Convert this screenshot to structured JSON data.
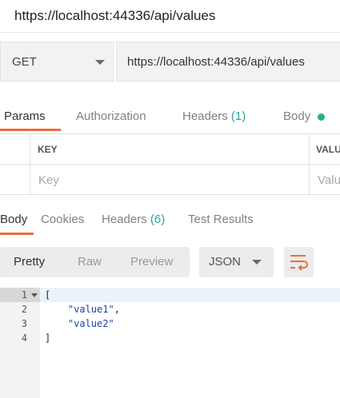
{
  "title_bar": {
    "title": "https://localhost:44336/api/values"
  },
  "request": {
    "method": "GET",
    "url": "https://localhost:44336/api/values"
  },
  "request_tabs": [
    {
      "label": "Params",
      "count": "",
      "active": true
    },
    {
      "label": "Authorization",
      "count": "",
      "active": false
    },
    {
      "label": "Headers",
      "count": "(1)",
      "active": false
    },
    {
      "label": "Body",
      "count": "",
      "active": false,
      "indicator": "green-dot"
    }
  ],
  "params_table": {
    "columns": [
      "KEY",
      "VALU"
    ],
    "placeholders": {
      "key": "Key",
      "value": "Valu"
    }
  },
  "response_tabs": [
    {
      "label": "Body",
      "count": "",
      "active": true
    },
    {
      "label": "Cookies",
      "count": "",
      "active": false
    },
    {
      "label": "Headers",
      "count": "(6)",
      "active": false
    },
    {
      "label": "Test Results",
      "count": "",
      "active": false
    }
  ],
  "response_toolbar": {
    "views": [
      "Pretty",
      "Raw",
      "Preview"
    ],
    "active_view": "Pretty",
    "format": "JSON",
    "wrap_icon": "wrap-lines-icon"
  },
  "editor": {
    "line_numbers": [
      "1",
      "2",
      "3",
      "4"
    ],
    "lines": [
      {
        "indent": "",
        "text": "["
      },
      {
        "indent": "    ",
        "text": "\"value1\"",
        "suffix": ","
      },
      {
        "indent": "    ",
        "text": "\"value2\"",
        "suffix": ""
      },
      {
        "indent": "",
        "text": "]"
      }
    ]
  },
  "colors": {
    "accent": "#f26b3a",
    "count": "#26a69a",
    "indicator": "#26b47e",
    "json_string": "#1a3fb3"
  }
}
